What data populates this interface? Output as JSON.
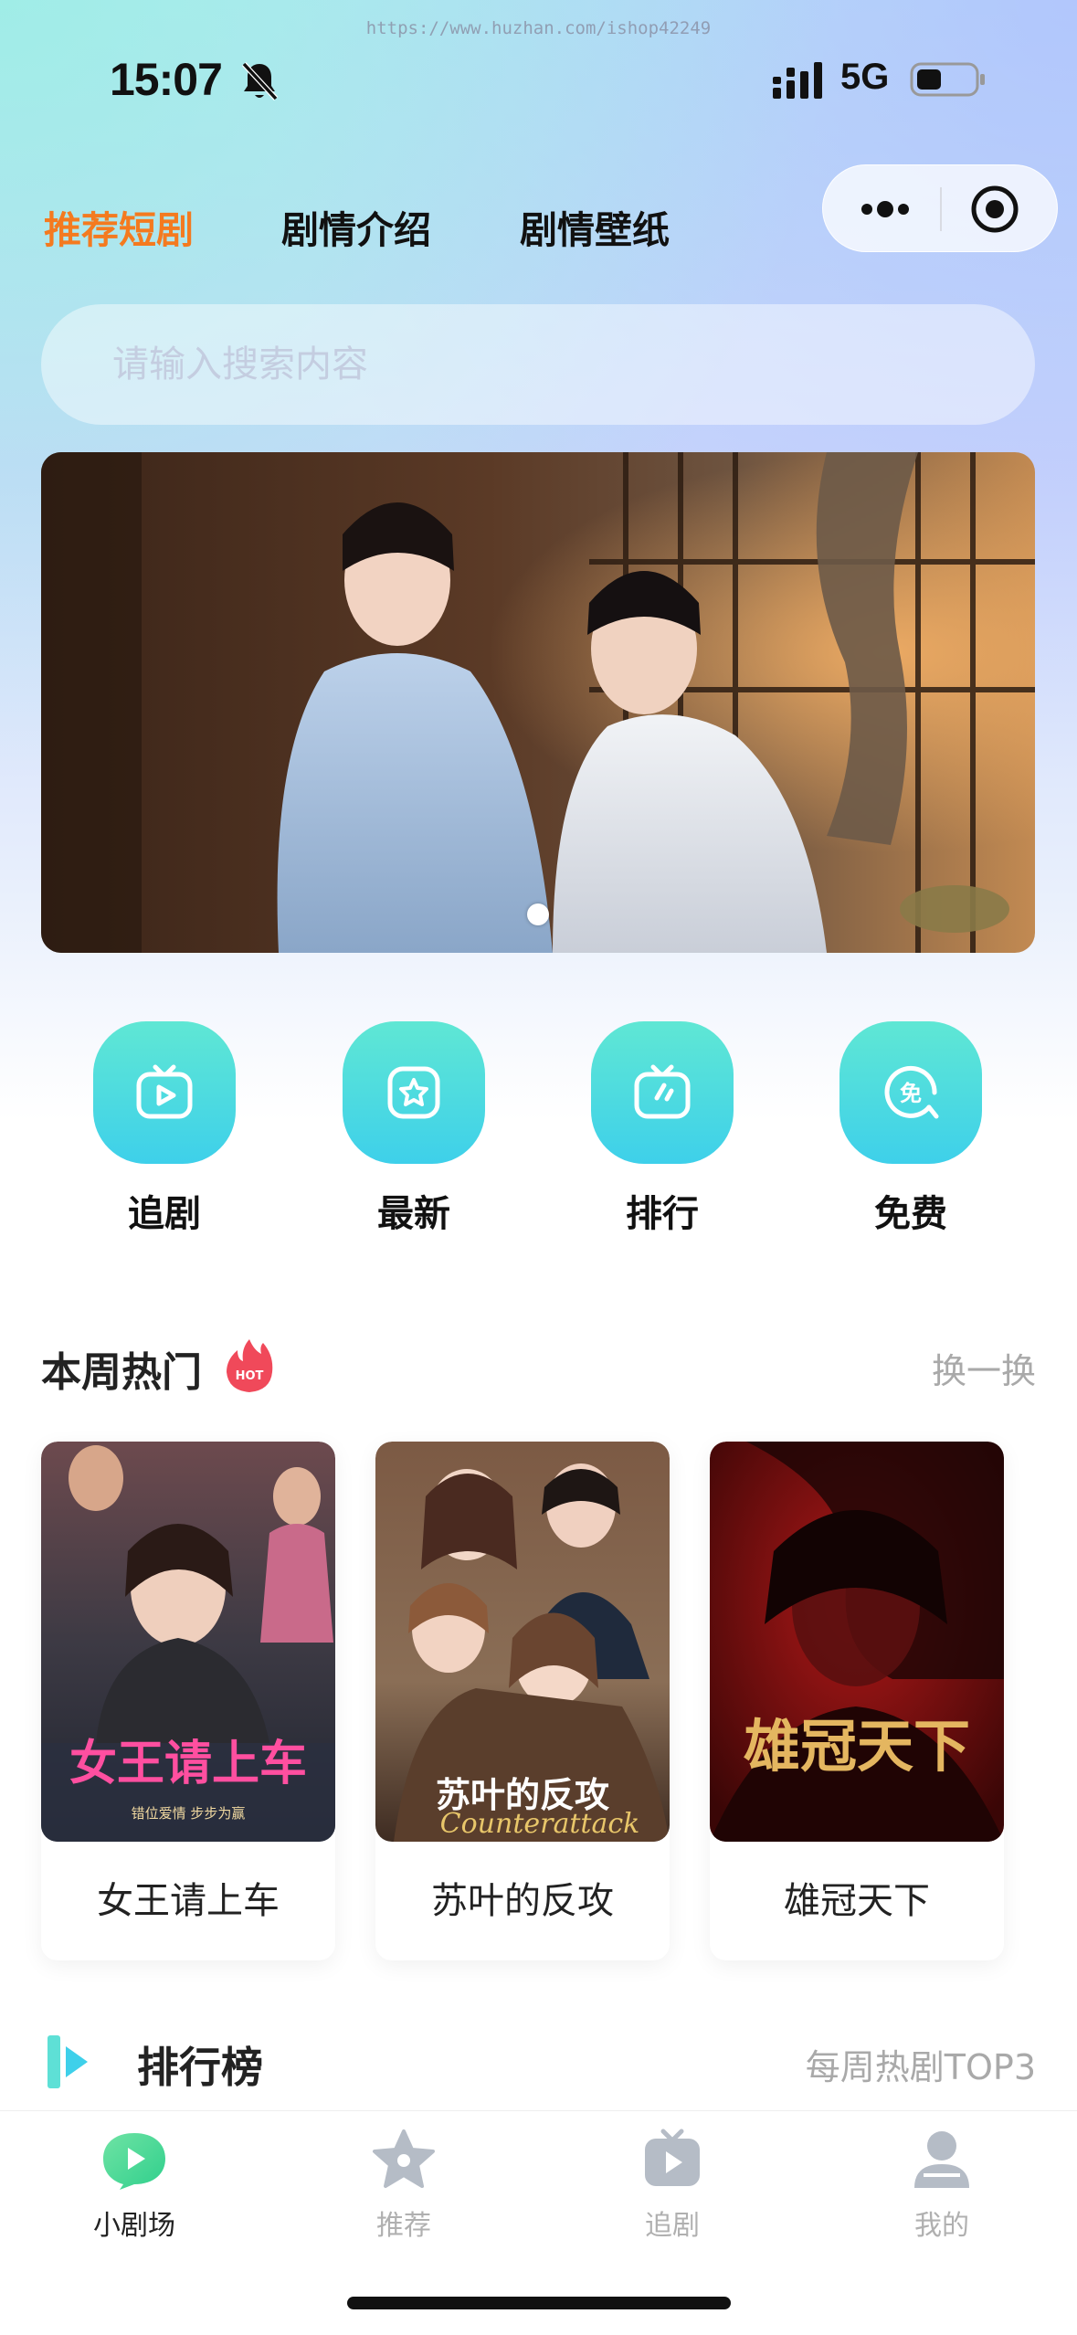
{
  "watermark": "https://www.huzhan.com/ishop42249",
  "status_bar": {
    "time": "15:07",
    "network": "5G",
    "icons": [
      "bell-slash-icon",
      "signal-icon",
      "battery-icon"
    ]
  },
  "header": {
    "tabs": [
      {
        "label": "推荐短剧",
        "active": true
      },
      {
        "label": "剧情介绍",
        "active": false
      },
      {
        "label": "剧情壁纸",
        "active": false
      }
    ],
    "capsule_icons": [
      "more-icon",
      "target-icon"
    ],
    "accent_color": "#f47a1f"
  },
  "search": {
    "placeholder": "请输入搜索内容",
    "value": ""
  },
  "banner": {
    "icon": "banner-image",
    "pagination_dots": 1
  },
  "quick_nav": [
    {
      "label": "追剧",
      "icon": "tv-play-icon"
    },
    {
      "label": "最新",
      "icon": "star-icon"
    },
    {
      "label": "排行",
      "icon": "tv-rank-icon"
    },
    {
      "label": "免费",
      "icon": "free-icon"
    }
  ],
  "hot_section": {
    "title": "本周热门",
    "badge": "HOT",
    "action": "换一换",
    "items": [
      {
        "title": "女王请上车",
        "poster_text": "女王请上车",
        "poster_sub": "错位爱情 步步为赢"
      },
      {
        "title": "苏叶的反攻",
        "poster_text": "苏叶的反攻",
        "poster_sub": "Counterattack"
      },
      {
        "title": "雄冠天下",
        "poster_text": "雄冠天下",
        "poster_sub": ""
      }
    ]
  },
  "ranking_section": {
    "title": "排行榜",
    "subtitle": "每周热剧TOP3"
  },
  "tab_bar": {
    "items": [
      {
        "label": "小剧场",
        "icon": "theater-icon",
        "active": true
      },
      {
        "label": "推荐",
        "icon": "star-icon",
        "active": false
      },
      {
        "label": "追剧",
        "icon": "tv-icon",
        "active": false
      },
      {
        "label": "我的",
        "icon": "user-icon",
        "active": false
      }
    ]
  },
  "colors": {
    "accent": "#f47a1f",
    "teal": "#3ed0ea",
    "muted": "#a9a9a9"
  }
}
